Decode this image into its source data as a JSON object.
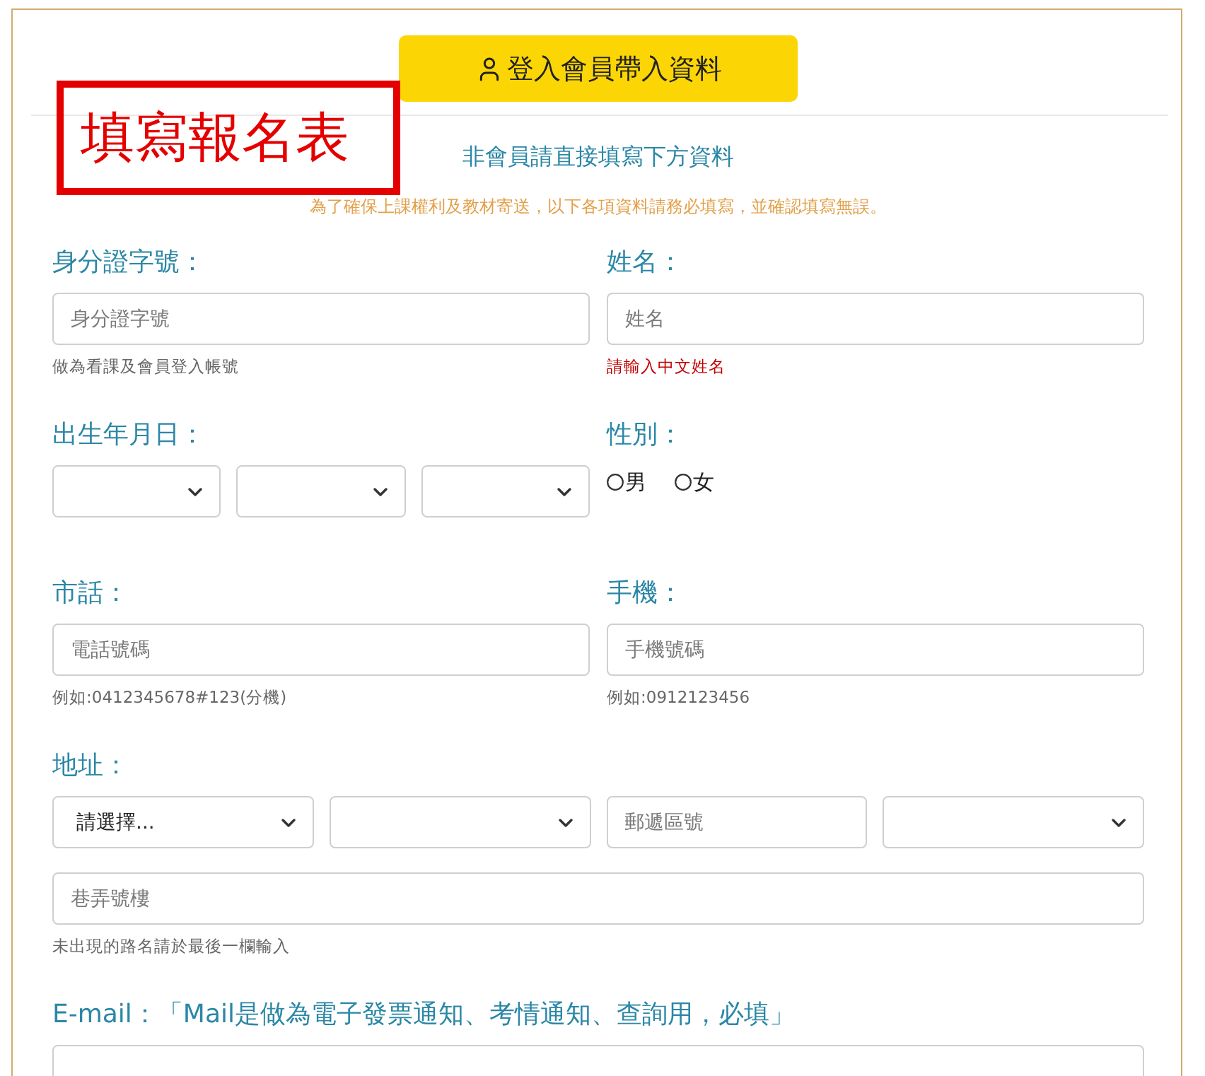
{
  "login_button": {
    "label": "登入會員帶入資料"
  },
  "annotation": {
    "text": "填寫報名表"
  },
  "subtitle": "非會員請直接填寫下方資料",
  "notice": "為了確保上課權利及教材寄送，以下各項資料請務必填寫，並確認填寫無誤。",
  "form_rows": [
    [
      {
        "label": "身分證字號：",
        "lines": [
          [
            {
              "kind": "input",
              "placeholder": "身分證字號"
            }
          ]
        ],
        "hint": {
          "text": "做為看課及會員登入帳號",
          "error": false
        }
      },
      {
        "label": "姓名：",
        "lines": [
          [
            {
              "kind": "input",
              "placeholder": "姓名"
            }
          ]
        ],
        "hint": {
          "text": "請輸入中文姓名",
          "error": true
        }
      }
    ],
    [
      {
        "label": "出生年月日：",
        "lines": [
          [
            {
              "kind": "select"
            },
            {
              "kind": "select"
            },
            {
              "kind": "select"
            }
          ]
        ]
      },
      {
        "label": "性別：",
        "lines": [
          [
            {
              "kind": "radio",
              "label": "男",
              "selected": false
            },
            {
              "kind": "radio",
              "label": "女",
              "selected": false
            }
          ]
        ]
      }
    ],
    [
      {
        "label": "市話：",
        "lines": [
          [
            {
              "kind": "input",
              "placeholder": "電話號碼"
            }
          ]
        ],
        "hint": {
          "text": "例如:0412345678#123(分機)",
          "error": false
        }
      },
      {
        "label": "手機：",
        "lines": [
          [
            {
              "kind": "input",
              "placeholder": "手機號碼"
            }
          ]
        ],
        "hint": {
          "text": "例如:0912123456",
          "error": false
        }
      }
    ],
    [
      {
        "label": "地址：",
        "lines": [
          [
            {
              "kind": "select",
              "value": "請選擇..."
            },
            {
              "kind": "select"
            },
            {
              "kind": "input",
              "placeholder": "郵遞區號"
            },
            {
              "kind": "select"
            }
          ],
          [
            {
              "kind": "input",
              "placeholder": "巷弄號樓"
            }
          ]
        ],
        "hint": {
          "text": "未出現的路名請於最後一欄輸入",
          "error": false
        }
      }
    ],
    [
      {
        "label": "E-mail：「Mail是做為電子發票通知、考情通知、查詢用，必填」",
        "lines": [
          [
            {
              "kind": "input"
            }
          ]
        ]
      }
    ]
  ]
}
